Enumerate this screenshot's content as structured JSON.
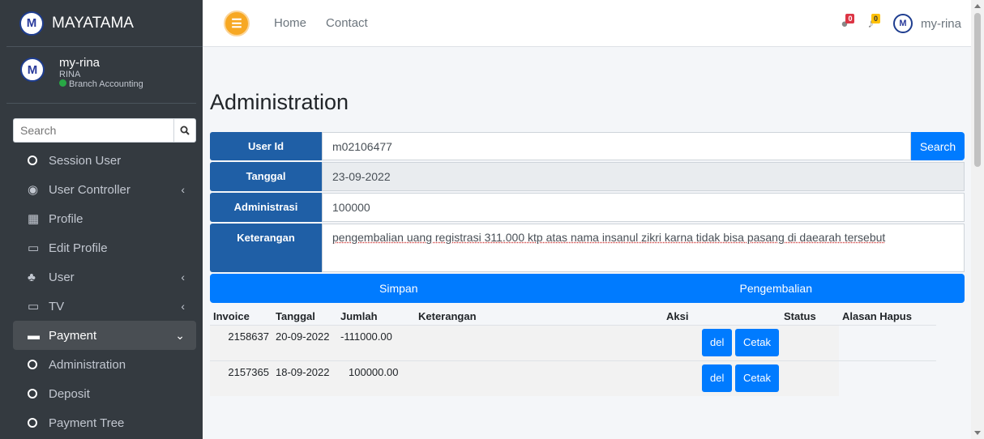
{
  "brand": {
    "name": "MAYATAMA",
    "logo_text": "M"
  },
  "user_panel": {
    "name": "my-rina",
    "sub": "RINA",
    "role": "Branch Accounting"
  },
  "sidebar": {
    "search_placeholder": "Search",
    "items": [
      {
        "label": "Session User",
        "icon": "circle-icon"
      },
      {
        "label": "User Controller",
        "icon": "user-circle-icon",
        "arrow": "‹"
      },
      {
        "label": "Profile",
        "icon": "grid-icon"
      },
      {
        "label": "Edit Profile",
        "icon": "laptop-icon"
      },
      {
        "label": "User",
        "icon": "user-plus-icon",
        "arrow": "‹"
      },
      {
        "label": "TV",
        "icon": "tv-icon",
        "arrow": "‹"
      },
      {
        "label": "Payment",
        "icon": "card-icon",
        "arrow": "⌄"
      },
      {
        "label": "Administration",
        "icon": "circle-icon"
      },
      {
        "label": "Deposit",
        "icon": "circle-icon"
      },
      {
        "label": "Payment Tree",
        "icon": "circle-icon"
      }
    ]
  },
  "topbar": {
    "home": "Home",
    "contact": "Contact",
    "messages_count": "0",
    "notifications_count": "0",
    "user": "my-rina"
  },
  "page": {
    "title": "Administration",
    "user_id_label": "User Id",
    "user_id_value": "m02106477",
    "search_button": "Search",
    "tanggal_label": "Tanggal",
    "tanggal_value": "23-09-2022",
    "administrasi_label": "Administrasi",
    "administrasi_value": "100000",
    "keterangan_label": "Keterangan",
    "keterangan_value": "pengembalian uang registrasi 311.000 ktp atas nama insanul zikri karna tidak bisa pasang di daearah tersebut",
    "simpan_button": "Simpan",
    "pengembalian_button": "Pengembalian"
  },
  "table": {
    "headers": [
      "Invoice",
      "Tanggal",
      "Jumlah",
      "Keterangan",
      "Aksi",
      "Status",
      "Alasan Hapus"
    ],
    "rows": [
      {
        "invoice": "2158637",
        "tanggal": "20-09-2022",
        "jumlah": "-111000.00",
        "del": "del",
        "cetak": "Cetak"
      },
      {
        "invoice": "2157365",
        "tanggal": "18-09-2022",
        "jumlah": "100000.00",
        "del": "del",
        "cetak": "Cetak"
      }
    ]
  },
  "colors": {
    "sidebar": "#343a40",
    "primary": "#007bff",
    "label_bg": "#1f5fa6"
  }
}
